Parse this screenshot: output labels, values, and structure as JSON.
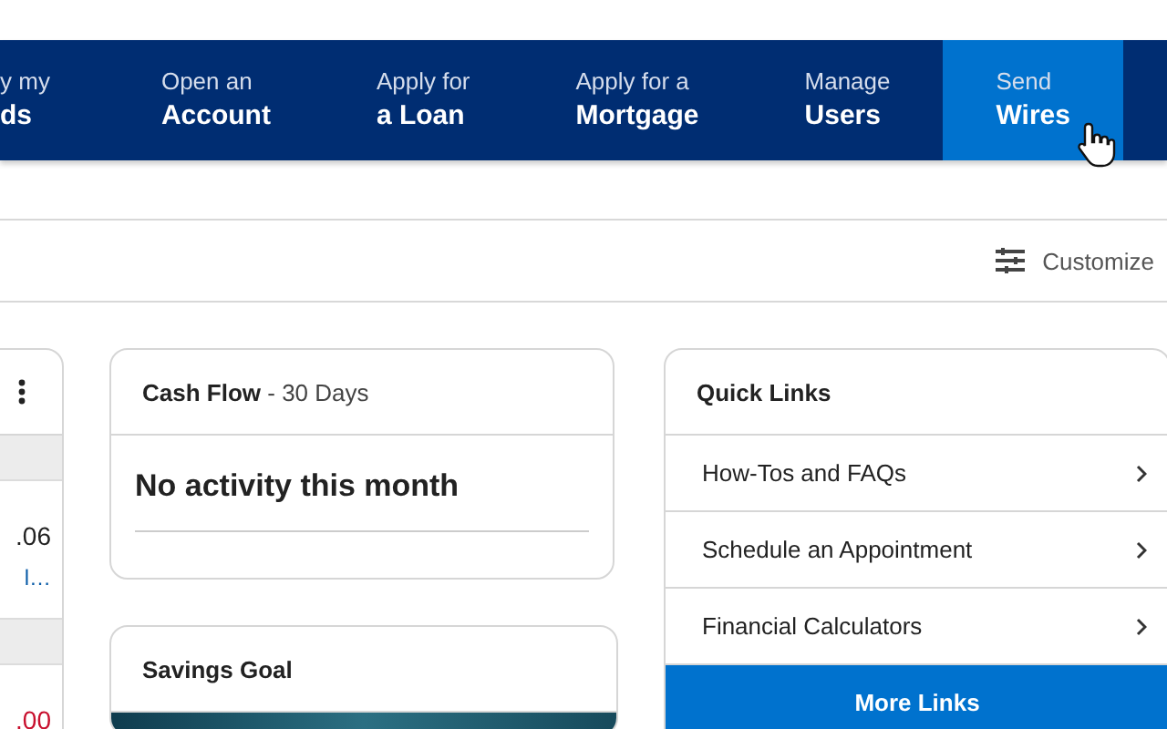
{
  "nav": [
    {
      "top": "y my",
      "bottom": "ds",
      "selected": false
    },
    {
      "top": "Open an",
      "bottom": "Account",
      "selected": false
    },
    {
      "top": "Apply for",
      "bottom": "a Loan",
      "selected": false
    },
    {
      "top": "Apply for a",
      "bottom": "Mortgage",
      "selected": false
    },
    {
      "top": "Manage",
      "bottom": "Users",
      "selected": false
    },
    {
      "top": "Send",
      "bottom": "Wires",
      "selected": true
    }
  ],
  "toolbar": {
    "customize": "Customize"
  },
  "accounts_card": {
    "rows": [
      {
        "amount": ".06",
        "negative": false,
        "link": "l…"
      },
      {
        "amount": ".00",
        "negative": true
      }
    ]
  },
  "cash_flow": {
    "title": "Cash Flow",
    "subtitle": " - 30 Days",
    "message": "No activity this month"
  },
  "savings_goal": {
    "title": "Savings Goal"
  },
  "quick_links": {
    "title": "Quick Links",
    "links": [
      "How-Tos and FAQs",
      "Schedule an Appointment",
      "Financial Calculators"
    ],
    "more": "More Links"
  }
}
